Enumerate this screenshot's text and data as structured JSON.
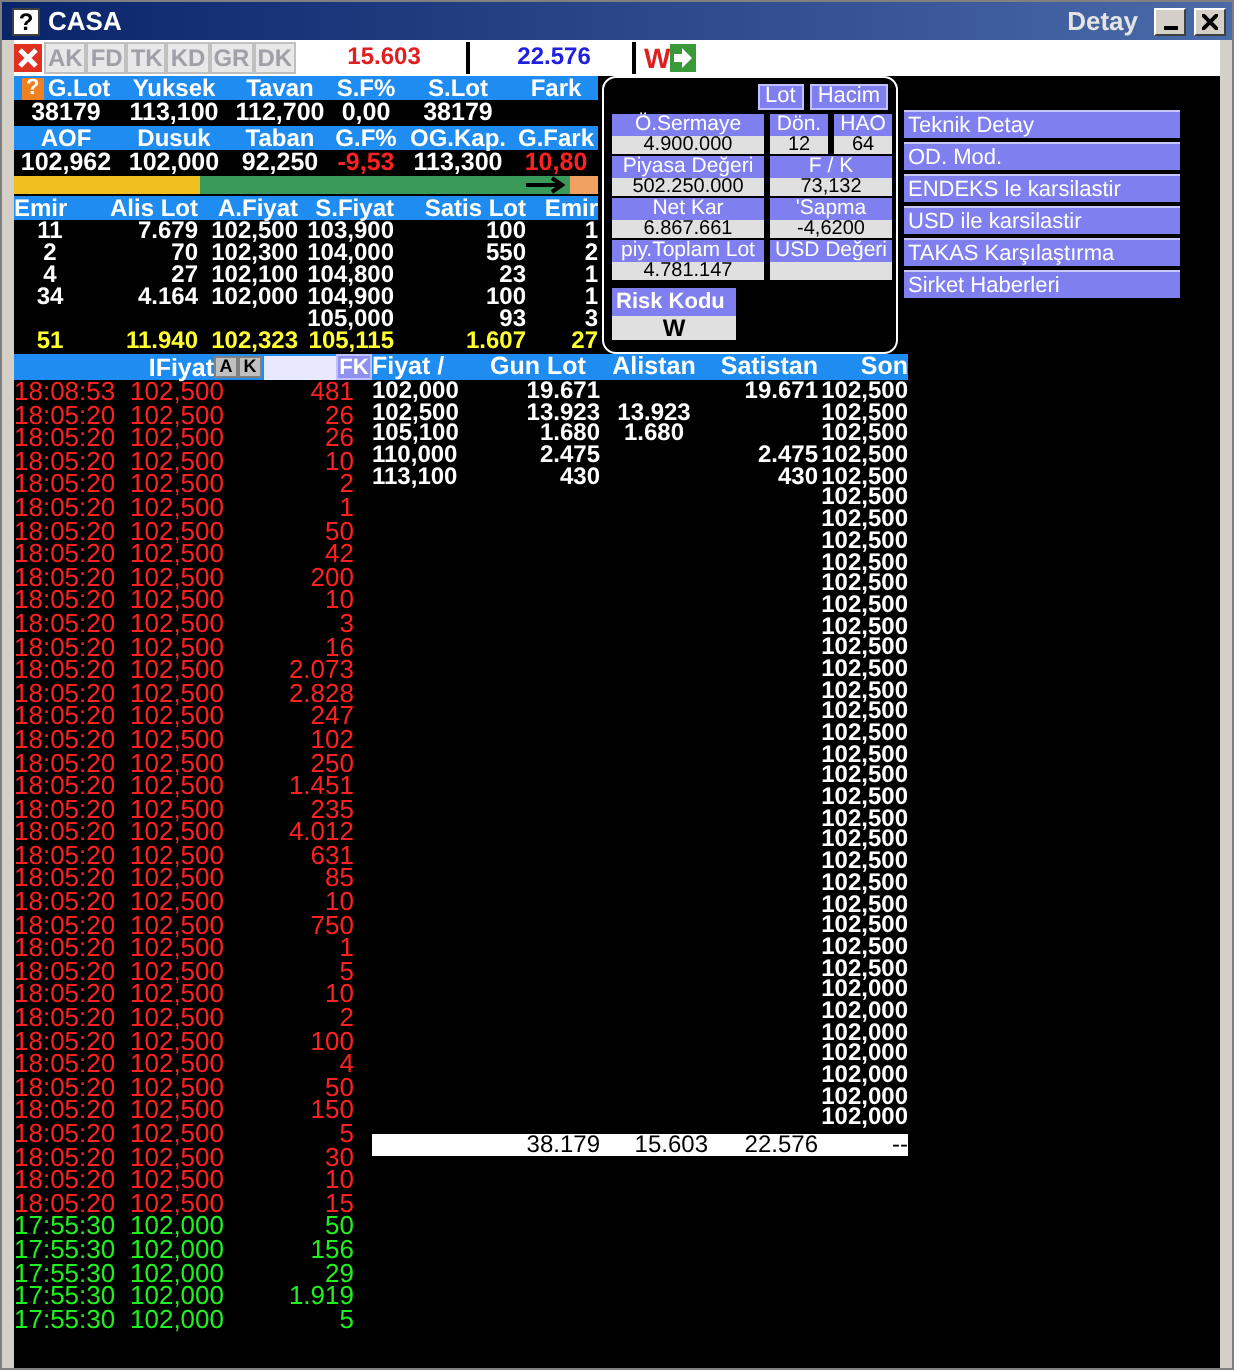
{
  "window": {
    "icon": "?",
    "title": "CASA",
    "detail": "Detay"
  },
  "toolbar": {
    "buttons": [
      {
        "label": "AK",
        "disabled": true
      },
      {
        "label": "FD",
        "disabled": true
      },
      {
        "label": "TK",
        "disabled": true
      },
      {
        "label": "KD",
        "disabled": true
      },
      {
        "label": "GR",
        "disabled": true
      },
      {
        "label": "DK",
        "disabled": true
      }
    ],
    "buy_total": "15.603",
    "sell_total": "22.576",
    "w_label": "W"
  },
  "summary": {
    "help": "?",
    "rows": [
      {
        "headers": [
          "G.Lot",
          "Yuksek",
          "Tavan",
          "S.F%",
          "S.Lot",
          "Fark"
        ],
        "values": [
          {
            "text": "38179",
            "kind": "plain"
          },
          {
            "text": "113,100",
            "kind": "plain"
          },
          {
            "text": "112,700",
            "kind": "plain"
          },
          {
            "text": "0,00",
            "kind": "plain"
          },
          {
            "text": "38179",
            "kind": "plain"
          }
        ]
      },
      {
        "headers": [
          "AOF",
          "Dusuk",
          "Taban",
          "G.F%",
          "OG.Kap.",
          "G.Fark"
        ],
        "values": [
          {
            "text": "102,962",
            "kind": "plain"
          },
          {
            "text": "102,000",
            "kind": "plain"
          },
          {
            "text": "92,250",
            "kind": "plain"
          },
          {
            "text": "-9,53",
            "kind": "down"
          },
          {
            "text": "113,300",
            "kind": "plain"
          },
          {
            "text": "10,80",
            "kind": "down"
          }
        ]
      }
    ]
  },
  "progress": {
    "level": 0.32
  },
  "order_book": {
    "columns": [
      "Emir",
      "Alis Lot",
      "A.Fiyat",
      "S.Fiyat",
      "Satis Lot",
      "Emir"
    ],
    "rows": [
      [
        "11",
        "7.679",
        "102,500",
        "103,900",
        "100",
        "1"
      ],
      [
        "2",
        "70",
        "102,300",
        "104,000",
        "550",
        "2"
      ],
      [
        "4",
        "27",
        "102,100",
        "104,800",
        "23",
        "1"
      ],
      [
        "34",
        "4.164",
        "102,000",
        "104,900",
        "100",
        "1"
      ],
      [
        "",
        "",
        "",
        "105,000",
        "93",
        "3"
      ]
    ],
    "total": [
      "51",
      "11.940",
      "102,323",
      "105,115",
      "1.607",
      "27"
    ]
  },
  "fundamentals": {
    "units": [
      "Lot",
      "Hacim"
    ],
    "fields": [
      {
        "label": "Ö.Sermaye",
        "value": "4.900.000"
      },
      {
        "label": "Dön.",
        "value": "12"
      },
      {
        "label": "HAO",
        "value": "64"
      },
      {
        "label": "Piyasa Değeri",
        "value": "502.250.000"
      },
      {
        "label": "F / K",
        "value": "73,132"
      },
      {
        "label": "Net Kar",
        "value": "6.867.661"
      },
      {
        "label": "'Sapma",
        "value": "-4,6200"
      },
      {
        "label": "piy.Toplam Lot",
        "value": "4.781.147"
      },
      {
        "label": "USD Değeri"
      }
    ],
    "risk": {
      "label": "Risk Kodu",
      "value": "W"
    }
  },
  "menu": [
    "Teknik Detay",
    "OD. Mod.",
    "ENDEKS le karsilastir",
    "USD ile karsilastir",
    "TAKAS Karşılaştırma",
    "Sirket Haberleri"
  ],
  "trades": {
    "header": "IFiyat",
    "buttons": [
      "A",
      "K"
    ],
    "fk": "FK",
    "rows": [
      {
        "time": "18:08:53",
        "price": "102,500",
        "lot": "481",
        "kind": "sell"
      },
      {
        "time": "18:05:20",
        "price": "102,500",
        "lot": "26",
        "kind": "sell"
      },
      {
        "time": "18:05:20",
        "price": "102,500",
        "lot": "26",
        "kind": "sell"
      },
      {
        "time": "18:05:20",
        "price": "102,500",
        "lot": "10",
        "kind": "sell"
      },
      {
        "time": "18:05:20",
        "price": "102,500",
        "lot": "2",
        "kind": "sell"
      },
      {
        "time": "18:05:20",
        "price": "102,500",
        "lot": "1",
        "kind": "sell"
      },
      {
        "time": "18:05:20",
        "price": "102,500",
        "lot": "50",
        "kind": "sell"
      },
      {
        "time": "18:05:20",
        "price": "102,500",
        "lot": "42",
        "kind": "sell"
      },
      {
        "time": "18:05:20",
        "price": "102,500",
        "lot": "200",
        "kind": "sell"
      },
      {
        "time": "18:05:20",
        "price": "102,500",
        "lot": "10",
        "kind": "sell"
      },
      {
        "time": "18:05:20",
        "price": "102,500",
        "lot": "3",
        "kind": "sell"
      },
      {
        "time": "18:05:20",
        "price": "102,500",
        "lot": "16",
        "kind": "sell"
      },
      {
        "time": "18:05:20",
        "price": "102,500",
        "lot": "2.073",
        "kind": "sell"
      },
      {
        "time": "18:05:20",
        "price": "102,500",
        "lot": "2.828",
        "kind": "sell"
      },
      {
        "time": "18:05:20",
        "price": "102,500",
        "lot": "247",
        "kind": "sell"
      },
      {
        "time": "18:05:20",
        "price": "102,500",
        "lot": "102",
        "kind": "sell"
      },
      {
        "time": "18:05:20",
        "price": "102,500",
        "lot": "250",
        "kind": "sell"
      },
      {
        "time": "18:05:20",
        "price": "102,500",
        "lot": "1.451",
        "kind": "sell"
      },
      {
        "time": "18:05:20",
        "price": "102,500",
        "lot": "235",
        "kind": "sell"
      },
      {
        "time": "18:05:20",
        "price": "102,500",
        "lot": "4.012",
        "kind": "sell"
      },
      {
        "time": "18:05:20",
        "price": "102,500",
        "lot": "631",
        "kind": "sell"
      },
      {
        "time": "18:05:20",
        "price": "102,500",
        "lot": "85",
        "kind": "sell"
      },
      {
        "time": "18:05:20",
        "price": "102,500",
        "lot": "10",
        "kind": "sell"
      },
      {
        "time": "18:05:20",
        "price": "102,500",
        "lot": "750",
        "kind": "sell"
      },
      {
        "time": "18:05:20",
        "price": "102,500",
        "lot": "1",
        "kind": "sell"
      },
      {
        "time": "18:05:20",
        "price": "102,500",
        "lot": "5",
        "kind": "sell"
      },
      {
        "time": "18:05:20",
        "price": "102,500",
        "lot": "10",
        "kind": "sell"
      },
      {
        "time": "18:05:20",
        "price": "102,500",
        "lot": "2",
        "kind": "sell"
      },
      {
        "time": "18:05:20",
        "price": "102,500",
        "lot": "100",
        "kind": "sell"
      },
      {
        "time": "18:05:20",
        "price": "102,500",
        "lot": "4",
        "kind": "sell"
      },
      {
        "time": "18:05:20",
        "price": "102,500",
        "lot": "50",
        "kind": "sell"
      },
      {
        "time": "18:05:20",
        "price": "102,500",
        "lot": "150",
        "kind": "sell"
      },
      {
        "time": "18:05:20",
        "price": "102,500",
        "lot": "5",
        "kind": "sell"
      },
      {
        "time": "18:05:20",
        "price": "102,500",
        "lot": "30",
        "kind": "sell"
      },
      {
        "time": "18:05:20",
        "price": "102,500",
        "lot": "10",
        "kind": "sell"
      },
      {
        "time": "18:05:20",
        "price": "102,500",
        "lot": "15",
        "kind": "sell"
      },
      {
        "time": "17:55:30",
        "price": "102,000",
        "lot": "50",
        "kind": "buy"
      },
      {
        "time": "17:55:30",
        "price": "102,000",
        "lot": "156",
        "kind": "buy"
      },
      {
        "time": "17:55:30",
        "price": "102,000",
        "lot": "29",
        "kind": "buy"
      },
      {
        "time": "17:55:30",
        "price": "102,000",
        "lot": "1.919",
        "kind": "buy"
      },
      {
        "time": "17:55:30",
        "price": "102,000",
        "lot": "5",
        "kind": "buy"
      }
    ]
  },
  "price_table": {
    "columns": [
      "Fiyat /",
      "Gun Lot",
      "Alistan",
      "Satistan",
      "Son"
    ],
    "rows": [
      {
        "fiyat": "102,000",
        "gun_lot": "19.671",
        "satistan": "19.671",
        "son": "102,500"
      },
      {
        "fiyat": "102,500",
        "gun_lot": "13.923",
        "alistan": "13.923",
        "son": "102,500"
      },
      {
        "fiyat": "105,100",
        "gun_lot": "1.680",
        "alistan": "1.680",
        "son": "102,500"
      },
      {
        "fiyat": "110,000",
        "gun_lot": "2.475",
        "satistan": "2.475",
        "son": "102,500"
      },
      {
        "fiyat": "113,100",
        "gun_lot": "430",
        "satistan": "430",
        "son": "102,500"
      },
      {
        "son": "102,500"
      },
      {
        "son": "102,500"
      },
      {
        "son": "102,500"
      },
      {
        "son": "102,500"
      },
      {
        "son": "102,500"
      },
      {
        "son": "102,500"
      },
      {
        "son": "102,500"
      },
      {
        "son": "102,500"
      },
      {
        "son": "102,500"
      },
      {
        "son": "102,500"
      },
      {
        "son": "102,500"
      },
      {
        "son": "102,500"
      },
      {
        "son": "102,500"
      },
      {
        "son": "102,500"
      },
      {
        "son": "102,500"
      },
      {
        "son": "102,500"
      },
      {
        "son": "102,500"
      },
      {
        "son": "102,500"
      },
      {
        "son": "102,500"
      },
      {
        "son": "102,500"
      },
      {
        "son": "102,500"
      },
      {
        "son": "102,500"
      },
      {
        "son": "102,500"
      },
      {
        "son": "102,000"
      },
      {
        "son": "102,000"
      },
      {
        "son": "102,000"
      },
      {
        "son": "102,000"
      },
      {
        "son": "102,000"
      },
      {
        "son": "102,000"
      },
      {
        "son": "102,000"
      }
    ],
    "total": {
      "gun_lot": "38.179",
      "alistan": "15.603",
      "satistan": "22.576",
      "son": "--"
    }
  }
}
